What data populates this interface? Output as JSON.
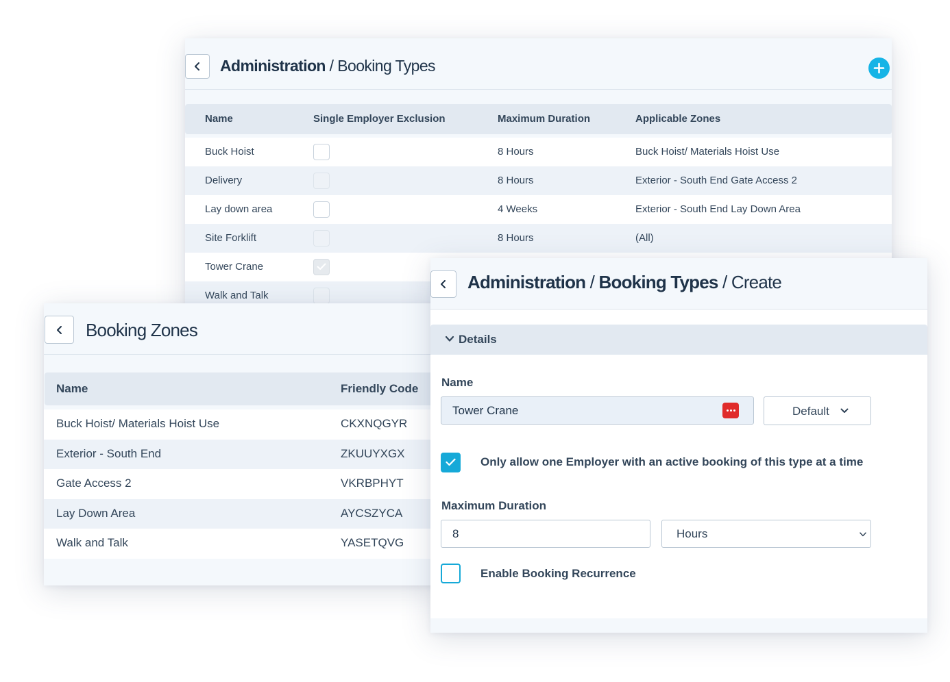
{
  "colors": {
    "accent": "#16a9d8",
    "text": "#33465a",
    "header_bg": "#e2e9f1",
    "password_manager": "#e02b2b"
  },
  "booking_types": {
    "breadcrumb_root": "Administration",
    "separator": " / ",
    "breadcrumb_current": "Booking Types",
    "add_icon": "plus-icon",
    "columns": [
      "Name",
      "Single Employer Exclusion",
      "Maximum Duration",
      "Applicable Zones"
    ],
    "rows": [
      {
        "name": "Buck Hoist",
        "exclusion": false,
        "duration": "8 Hours",
        "zones": "Buck Hoist/ Materials Hoist Use"
      },
      {
        "name": "Delivery",
        "exclusion": false,
        "duration": "8 Hours",
        "zones": "Exterior - South End Gate Access 2"
      },
      {
        "name": "Lay down area",
        "exclusion": false,
        "duration": "4 Weeks",
        "zones": "Exterior - South End Lay Down Area"
      },
      {
        "name": "Site Forklift",
        "exclusion": false,
        "duration": "8 Hours",
        "zones": "(All)"
      },
      {
        "name": "Tower Crane",
        "exclusion": true,
        "duration": "",
        "zones": ""
      },
      {
        "name": "Walk and Talk",
        "exclusion": false,
        "duration": "",
        "zones": ""
      }
    ]
  },
  "booking_zones": {
    "title": "Booking Zones",
    "columns": [
      "Name",
      "Friendly Code"
    ],
    "rows": [
      {
        "name": "Buck Hoist/ Materials Hoist Use",
        "code": "CKXNQGYR"
      },
      {
        "name": "Exterior - South End",
        "code": "ZKUUYXGX"
      },
      {
        "name": "Gate Access 2",
        "code": "VKRBPHYT"
      },
      {
        "name": "Lay Down Area",
        "code": "AYCSZYCA"
      },
      {
        "name": "Walk and Talk",
        "code": "YASETQVG"
      }
    ]
  },
  "create_form": {
    "breadcrumb_root": "Administration",
    "breadcrumb_mid": "Booking Types",
    "breadcrumb_current": "Create",
    "separator": " / ",
    "section_title": "Details",
    "name_label": "Name",
    "name_value": "Tower Crane",
    "language_dropdown": "Default",
    "exclusion_checked": true,
    "exclusion_label": "Only allow one Employer with an active booking of this type at a time",
    "duration_label": "Maximum Duration",
    "duration_value": "8",
    "duration_unit": "Hours",
    "recurrence_checked": false,
    "recurrence_label": "Enable Booking Recurrence"
  }
}
